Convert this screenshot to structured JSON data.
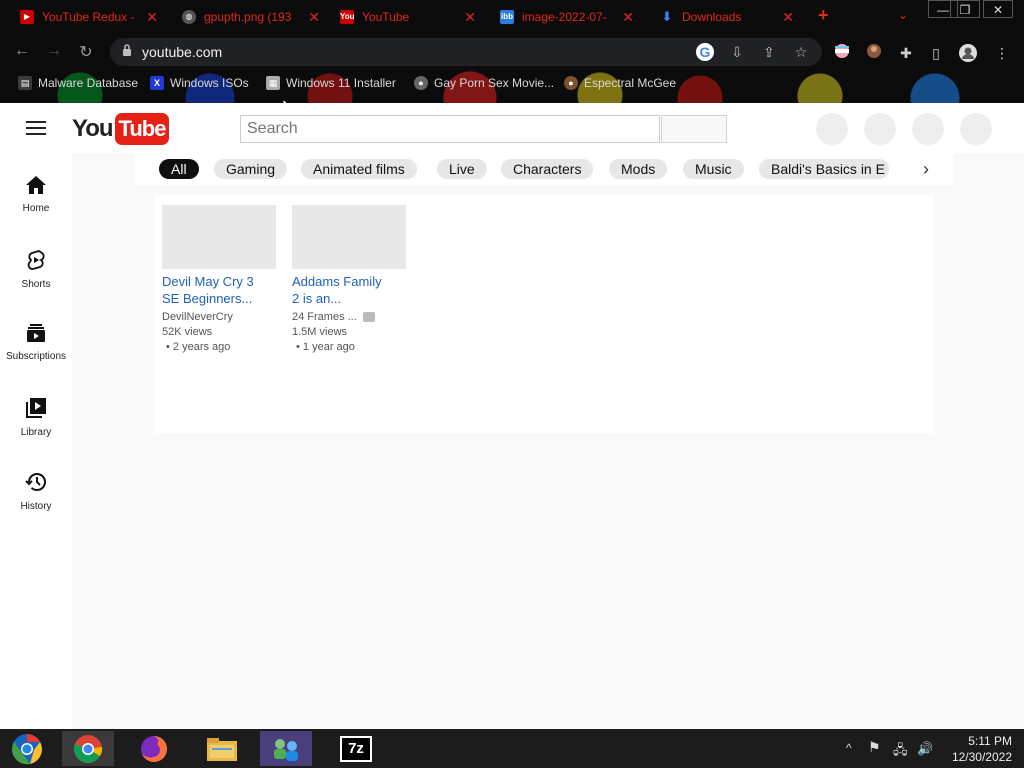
{
  "browser": {
    "tabs": [
      {
        "label": "YouTube Redux -",
        "favicon": "youtube-redux-favicon"
      },
      {
        "label": "gpupth.png (193",
        "favicon": "globe-icon"
      },
      {
        "label": "YouTube",
        "favicon": "youtube-favicon",
        "active": true
      },
      {
        "label": "image-2022-07-",
        "favicon": "ibb-favicon"
      },
      {
        "label": "Downloads",
        "favicon": "download-icon"
      }
    ],
    "new_tab": "+",
    "url": "youtube.com",
    "bookmarks": [
      {
        "label": "Malware Database",
        "icon": "folder-icon"
      },
      {
        "label": "Windows ISOs",
        "icon": "x-logo-icon"
      },
      {
        "label": "Windows 11 Installer",
        "icon": "image-icon"
      },
      {
        "label": "Gay Porn Sex Movie...",
        "icon": "site-icon"
      },
      {
        "label": "Espectral McGee",
        "icon": "site-icon"
      }
    ]
  },
  "youtube": {
    "logo_you": "You",
    "logo_tube": "Tube",
    "search_placeholder": "Search",
    "sidebar": [
      {
        "label": "Home",
        "icon": "home-icon"
      },
      {
        "label": "Shorts",
        "icon": "shorts-icon"
      },
      {
        "label": "Subscriptions",
        "icon": "subscriptions-icon"
      },
      {
        "label": "Library",
        "icon": "library-icon"
      },
      {
        "label": "History",
        "icon": "history-icon"
      }
    ],
    "chips": [
      "All",
      "Gaming",
      "Animated films",
      "Live",
      "Characters",
      "Mods",
      "Music",
      "Baldi's Basics in E"
    ],
    "videos": [
      {
        "title_line1": "Devil May Cry 3",
        "title_line2": "SE Beginners...",
        "channel": "DevilNeverCry",
        "verified": false,
        "views": "52K views",
        "date": "• 2 years ago"
      },
      {
        "title_line1": "Addams Family",
        "title_line2": "2 is an...",
        "channel": "24 Frames ...",
        "verified": true,
        "views": "1.5M views",
        "date": "• 1 year ago"
      }
    ]
  },
  "taskbar": {
    "apps": [
      "chrome-start-orb",
      "chrome-icon",
      "firefox-icon",
      "file-explorer-icon",
      "network-people-icon",
      "7zip-icon"
    ],
    "seven_zip_label": "7z",
    "time": "5:11 PM",
    "date": "12/30/2022"
  },
  "colors": {
    "tab_red": "#e0281e",
    "yt_red": "#e62117",
    "link_blue": "#1c62b9"
  }
}
